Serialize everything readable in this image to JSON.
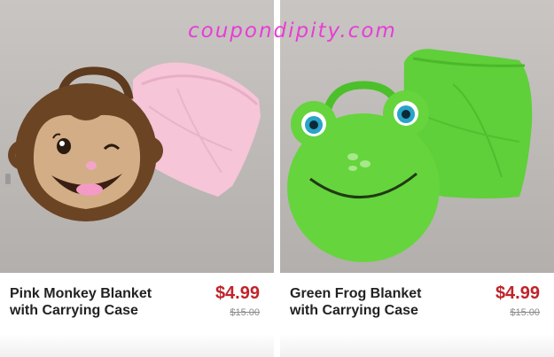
{
  "watermark": {
    "text": "coupondipity.com",
    "color": "#e83cd6"
  },
  "theme": {
    "price_color": "#c0232a"
  },
  "products": [
    {
      "name": "Pink Monkey Blanket with Carrying Case",
      "price": "$4.99",
      "original_price": "$15.00",
      "image_icon": "monkey-blanket-image"
    },
    {
      "name": "Green Frog Blanket with Carrying Case",
      "price": "$4.99",
      "original_price": "$15.00",
      "image_icon": "frog-blanket-image"
    }
  ]
}
